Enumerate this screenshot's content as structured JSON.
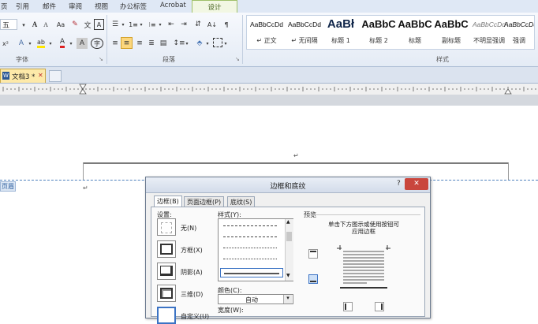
{
  "ribbon": {
    "tabs": [
      "页",
      "引用",
      "邮件",
      "审阅",
      "视图",
      "办公标签",
      "Acrobat",
      "设计"
    ],
    "font": {
      "size_value": "五",
      "group_label": "字体"
    },
    "paragraph": {
      "group_label": "段落"
    },
    "styles": {
      "group_label": "样式",
      "items": [
        {
          "sample": "AaBbCcDd",
          "name": "↵ 正文"
        },
        {
          "sample": "AaBbCcDd",
          "name": "↵ 无间隔"
        },
        {
          "sample": "AaBł",
          "name": "标题 1"
        },
        {
          "sample": "AaBbC",
          "name": "标题 2"
        },
        {
          "sample": "AaBbC",
          "name": "标题"
        },
        {
          "sample": "AaBbC",
          "name": "副标题"
        },
        {
          "sample": "AaBbCcDd",
          "name": "不明显强调"
        },
        {
          "sample": "AaBbCcDd",
          "name": "强调"
        }
      ]
    }
  },
  "document": {
    "tab_title": "文档3 *",
    "close_glyph": "✕",
    "header_label": "页眉",
    "paragraph_mark": "↵"
  },
  "dialog": {
    "title": "边框和底纹",
    "help_glyph": "?",
    "close_glyph": "✕",
    "tabs": [
      "边框(B)",
      "页面边框(P)",
      "底纹(S)"
    ],
    "settings_label": "设置:",
    "settings": [
      "无(N)",
      "方框(X)",
      "阴影(A)",
      "三维(D)",
      "自定义(U)"
    ],
    "style_label": "样式(Y):",
    "color_label": "颜色(C):",
    "color_value": "自动",
    "width_label": "宽度(W):",
    "preview_label": "预览",
    "preview_hint_line1": "单击下方图示或使用按钮可",
    "preview_hint_line2": "应用边框"
  },
  "colors": {
    "ribbon_bg": "#e4ebf5",
    "design_tab": "#9fc06a",
    "dialog_close": "#c9463d",
    "header_dash": "#4f81bd"
  }
}
